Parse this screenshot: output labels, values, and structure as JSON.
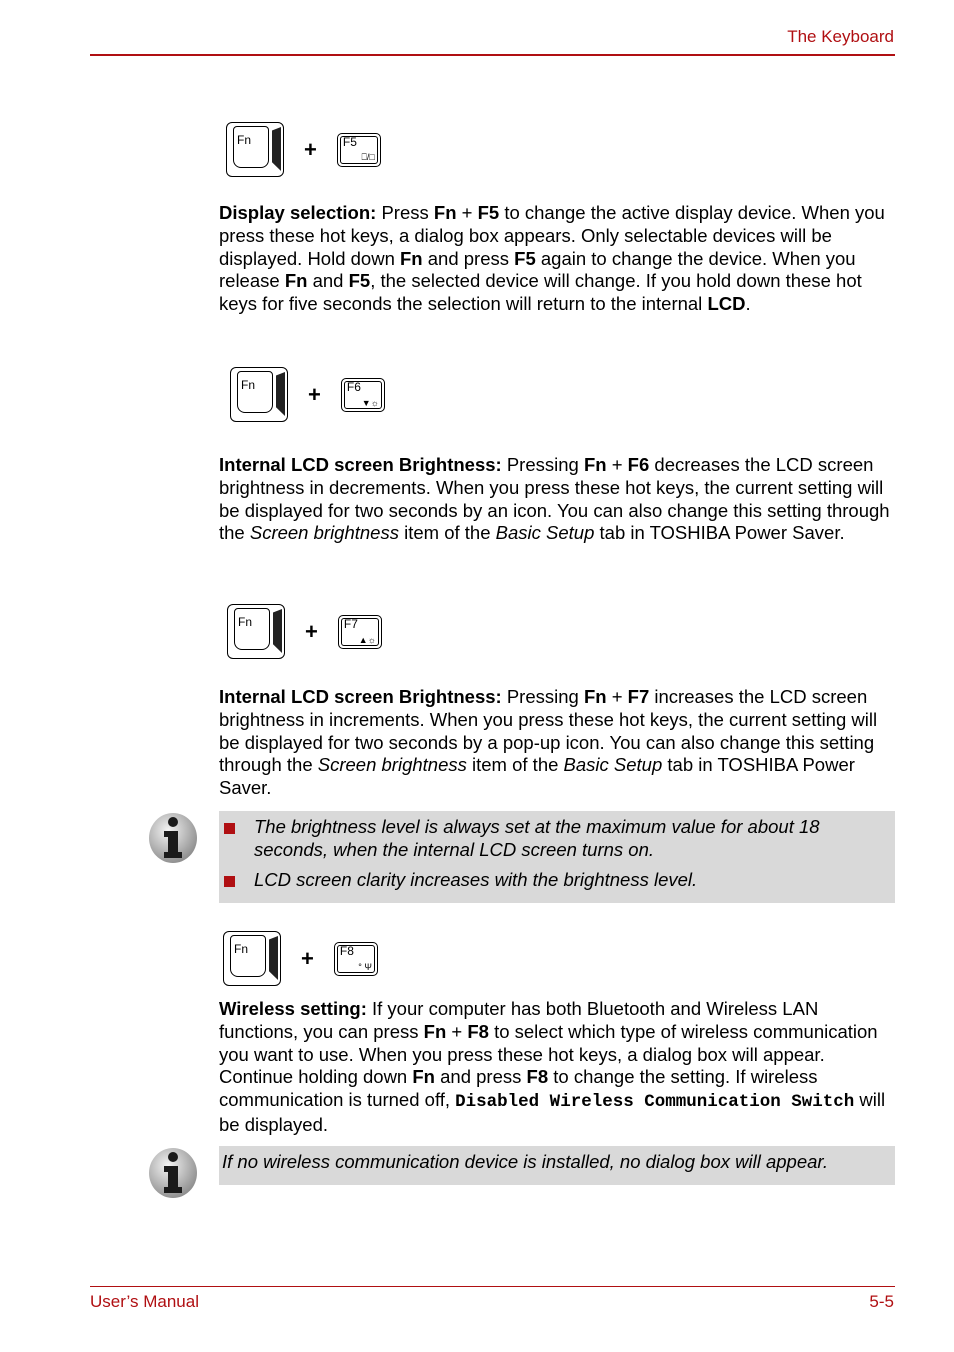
{
  "header": {
    "title": "The Keyboard"
  },
  "footer": {
    "left": "User’s Manual",
    "right": "5-5"
  },
  "hotkeys": [
    {
      "fn_label": "Fn",
      "plus": "+",
      "fkey_label": "F5",
      "fkey_symbol": "⎕/□",
      "fkey_icon": "display-switch-icon"
    },
    {
      "fn_label": "Fn",
      "plus": "+",
      "fkey_label": "F6",
      "fkey_symbol": "▼☼",
      "fkey_icon": "brightness-down-icon"
    },
    {
      "fn_label": "Fn",
      "plus": "+",
      "fkey_label": "F7",
      "fkey_symbol": "▲☼",
      "fkey_icon": "brightness-up-icon"
    },
    {
      "fn_label": "Fn",
      "plus": "+",
      "fkey_label": "F8",
      "fkey_symbol": "° Ψ",
      "fkey_icon": "wireless-icon"
    }
  ],
  "sections": {
    "display": {
      "title": "Display selection:",
      "t1": " Press ",
      "b1": "Fn",
      "t2": " + ",
      "b2": "F5",
      "t3": " to change the active display device. When you press these hot keys, a dialog box appears. Only selectable devices will be displayed. Hold down ",
      "b3": "Fn",
      "t4": " and press ",
      "b4": "F5",
      "t5": " again to change the device. When you release ",
      "b5": "Fn",
      "t6": " and ",
      "b6": "F5",
      "t7": ", the selected device will change. If you hold down these hot keys for five seconds the selection will return to the internal ",
      "b7": "LCD",
      "t8": "."
    },
    "bright_down": {
      "title": "Internal LCD screen Brightness:",
      "t1": " Pressing ",
      "b1": "Fn",
      "t2": " + ",
      "b2": "F6",
      "t3": " decreases the LCD screen brightness in decrements. When you press these hot keys, the current setting will be displayed for two seconds by an icon. You can also change this setting through the ",
      "i1": "Screen brightness",
      "t4": " item of the ",
      "i2": "Basic Setup",
      "t5": " tab in TOSHIBA Power Saver."
    },
    "bright_up": {
      "title": "Internal LCD screen Brightness:",
      "t1": " Pressing ",
      "b1": "Fn",
      "t2": " + ",
      "b2": "F7",
      "t3": " increases the LCD screen brightness in increments. When you press these hot keys, the current setting will be displayed for two seconds by a pop-up icon. You can also change this setting through the ",
      "i1": "Screen brightness",
      "t4": " item of the ",
      "i2": "Basic Setup",
      "t5": " tab in TOSHIBA Power Saver."
    },
    "wireless": {
      "title": "Wireless setting:",
      "t1": " If your computer has both Bluetooth and Wireless LAN functions, you can press ",
      "b1": "Fn",
      "t2": " + ",
      "b2": "F8",
      "t3": " to select which type of wireless communication you want to use. When you press these hot keys, a dialog box will appear. Continue holding down ",
      "b3": "Fn",
      "t4": " and press ",
      "b4": "F8",
      "t5": " to change the setting. If wireless communication is turned off, ",
      "m1": "Disabled Wireless Communication Switch",
      "t6": " will be displayed."
    }
  },
  "notes": [
    {
      "items": [
        "The brightness level is always set at the maximum value for about 18 seconds, when the internal LCD screen turns on.",
        "LCD screen clarity increases with the brightness level."
      ]
    },
    {
      "text": "If no wireless communication device is installed, no dialog box will appear."
    }
  ]
}
